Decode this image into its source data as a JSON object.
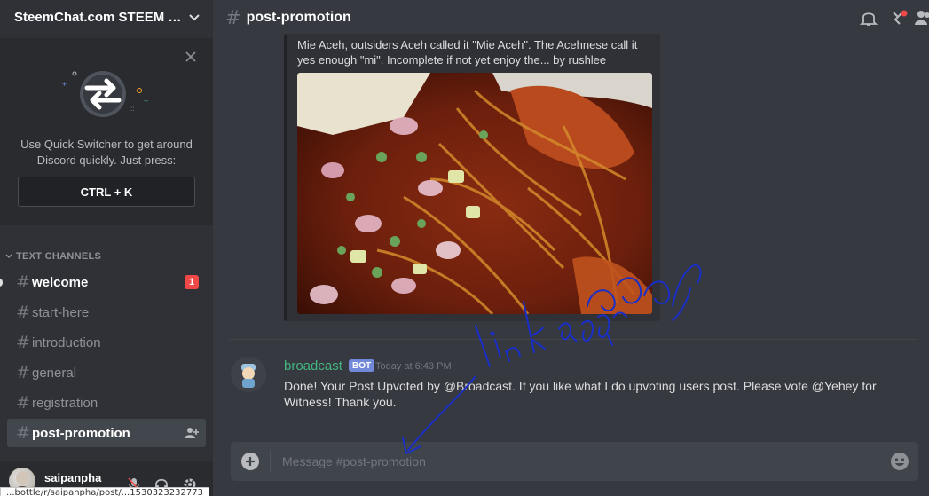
{
  "server": {
    "name": "SteemChat.com STEEM C..."
  },
  "quick_switcher": {
    "text": "Use Quick Switcher to get around Discord quickly. Just press:",
    "shortcut": "CTRL + K"
  },
  "sidebar": {
    "heading": "TEXT CHANNELS",
    "channels": [
      {
        "name": "welcome",
        "badge": "1"
      },
      {
        "name": "start-here"
      },
      {
        "name": "introduction"
      },
      {
        "name": "general"
      },
      {
        "name": "registration"
      },
      {
        "name": "post-promotion"
      }
    ]
  },
  "user": {
    "name": "saipanpha"
  },
  "status_url": "...bottle/r/saipanpha/post/...1530323232773",
  "header": {
    "channel": "post-promotion"
  },
  "embed": {
    "description": "Mie Aceh, outsiders Aceh called it \"Mie Aceh\". The Acehnese call it yes enough \"mi\". Incomplete if not yet enjoy the... by rushlee",
    "image_subject": "Mie Aceh noodle dish"
  },
  "message": {
    "author": "broadcast",
    "tag": "BOT",
    "timestamp": "Today at 6:43 PM",
    "text": "Done! Your Post Upvoted by @Broadcast. If you like what I do upvoting users post. Please vote @Yehey for Witness! Thank you."
  },
  "composer": {
    "placeholder": "Message #post-promotion"
  },
  "annotation": {
    "color": "#1a2fc8"
  },
  "colors": {
    "accent": "#7289da",
    "bot_name": "#43b581",
    "mention": "#f04747"
  }
}
